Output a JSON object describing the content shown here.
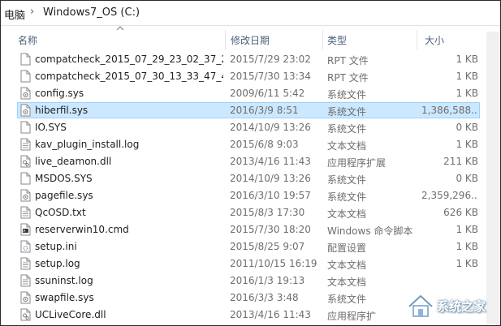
{
  "breadcrumb": {
    "prefix": "电脑",
    "separator": "›",
    "drive": "Windows7_OS (C:)"
  },
  "columns": {
    "name": "名称",
    "date": "修改日期",
    "type": "类型",
    "size": "大小"
  },
  "selected_index": 3,
  "files": [
    {
      "name": "compatcheck_2015_07_29_23_02_37_2...",
      "date": "2015/7/29 23:02",
      "type": "RPT 文件",
      "size": "1 KB",
      "icon": "file-icon"
    },
    {
      "name": "compatcheck_2015_07_30_13_33_47_4...",
      "date": "2015/7/30 13:34",
      "type": "RPT 文件",
      "size": "1 KB",
      "icon": "file-icon"
    },
    {
      "name": "config.sys",
      "date": "2009/6/11 5:42",
      "type": "系统文件",
      "size": "1 KB",
      "icon": "system-file-icon"
    },
    {
      "name": "hiberfil.sys",
      "date": "2016/3/9 8:51",
      "type": "系统文件",
      "size": "1,386,588...",
      "icon": "system-file-icon"
    },
    {
      "name": "IO.SYS",
      "date": "2014/10/9 13:26",
      "type": "系统文件",
      "size": "0 KB",
      "icon": "file-icon"
    },
    {
      "name": "kav_plugin_install.log",
      "date": "2015/6/8 9:03",
      "type": "文本文档",
      "size": "1 KB",
      "icon": "text-file-icon"
    },
    {
      "name": "live_deamon.dll",
      "date": "2013/4/16 11:43",
      "type": "应用程序扩展",
      "size": "211 KB",
      "icon": "dll-file-icon"
    },
    {
      "name": "MSDOS.SYS",
      "date": "2014/10/9 13:26",
      "type": "系统文件",
      "size": "0 KB",
      "icon": "file-icon"
    },
    {
      "name": "pagefile.sys",
      "date": "2016/3/10 19:57",
      "type": "系统文件",
      "size": "2,359,296...",
      "icon": "system-file-icon"
    },
    {
      "name": "QcOSD.txt",
      "date": "2015/8/3 17:30",
      "type": "文本文档",
      "size": "626 KB",
      "icon": "text-file-icon"
    },
    {
      "name": "reserverwin10.cmd",
      "date": "2015/7/30 18:20",
      "type": "Windows 命令脚本",
      "size": "1 KB",
      "icon": "cmd-file-icon"
    },
    {
      "name": "setup.ini",
      "date": "2015/8/25 9:07",
      "type": "配置设置",
      "size": "1 KB",
      "icon": "ini-file-icon"
    },
    {
      "name": "setup.log",
      "date": "2011/10/15 16:19",
      "type": "文本文档",
      "size": "1 KB",
      "icon": "text-file-icon"
    },
    {
      "name": "ssuninst.log",
      "date": "2016/1/3 19:13",
      "type": "文本文档",
      "size": "",
      "icon": "text-file-icon"
    },
    {
      "name": "swapfile.sys",
      "date": "2016/3/3 3:48",
      "type": "系统文件",
      "size": "",
      "icon": "system-file-icon"
    },
    {
      "name": "UCLiveCore.dll",
      "date": "2013/4/16 11:43",
      "type": "应用程序扩",
      "size": "",
      "icon": "dll-file-icon"
    }
  ],
  "watermark": {
    "text": "系统之家",
    "icon": "house-logo-icon"
  },
  "colors": {
    "selection_bg": "#cce8ff",
    "selection_border": "#99d1ff",
    "header_text": "#4c607a"
  }
}
